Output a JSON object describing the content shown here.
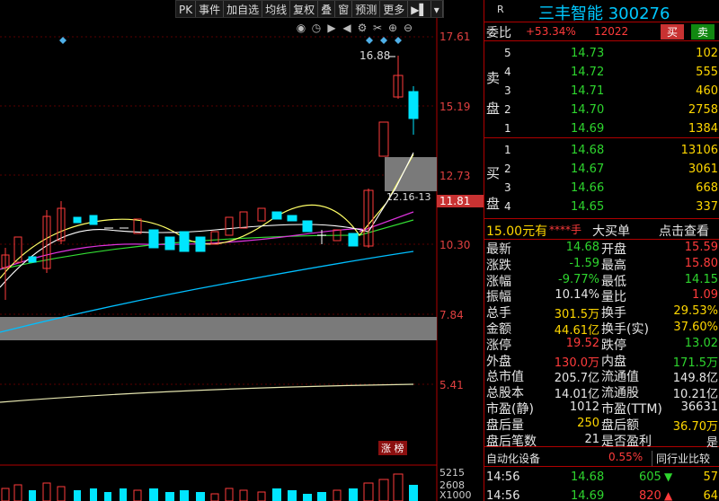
{
  "toolbar": {
    "items": [
      "PK",
      "事件",
      "加自选",
      "均线",
      "复权",
      "叠",
      "窗",
      "预测",
      "更多",
      "▶▌",
      "▾"
    ]
  },
  "chart_icons": [
    "eye-icon",
    "clock-icon",
    "play-icon",
    "back-icon",
    "gear-icon",
    "scissors-icon",
    "plus-icon",
    "minus-icon"
  ],
  "price_axis": [
    "17.61",
    "15.19",
    "12.73",
    "11.81",
    "10.30",
    "7.84",
    "5.41"
  ],
  "high_label": "16.88",
  "low_label": "12.16-13",
  "tag_zhangbang": "涨 榜",
  "vol_axis": [
    "5215",
    "2608",
    "X1000"
  ],
  "header": {
    "r": "R",
    "name": "三丰智能",
    "code": "300276",
    "wb_label": "委比",
    "wb_value": "+53.34%",
    "wc_value": "12022",
    "buy": "买",
    "sell": "卖"
  },
  "sell_levels": [
    {
      "level": "5",
      "price": "14.73",
      "vol": "102"
    },
    {
      "level": "4",
      "price": "14.72",
      "vol": "555"
    },
    {
      "level": "3",
      "price": "14.71",
      "vol": "460"
    },
    {
      "level": "2",
      "price": "14.70",
      "vol": "2758"
    },
    {
      "level": "1",
      "price": "14.69",
      "vol": "1384"
    }
  ],
  "buy_levels": [
    {
      "level": "1",
      "price": "14.68",
      "vol": "13106"
    },
    {
      "level": "2",
      "price": "14.67",
      "vol": "3061"
    },
    {
      "level": "3",
      "price": "14.66",
      "vol": "668"
    },
    {
      "level": "4",
      "price": "14.65",
      "vol": "337"
    }
  ],
  "side_labels": {
    "sell1": "卖",
    "sell2": "盘",
    "buy1": "买",
    "buy2": "盘"
  },
  "order": {
    "price": "15.00元有",
    "stars": "****手",
    "big": "大买单",
    "link": "点击查看"
  },
  "stats": [
    [
      "最新",
      "14.68",
      "开盘",
      "15.59"
    ],
    [
      "涨跌",
      "-1.59",
      "最高",
      "15.80"
    ],
    [
      "涨幅",
      "-9.77%",
      "最低",
      "14.15"
    ],
    [
      "振幅",
      "10.14%",
      "量比",
      "1.09"
    ],
    [
      "总手",
      "301.5万",
      "换手",
      "29.53%"
    ],
    [
      "金额",
      "44.61亿",
      "换手(实)",
      "37.60%"
    ],
    [
      "涨停",
      "19.52",
      "跌停",
      "13.02"
    ],
    [
      "外盘",
      "130.0万",
      "内盘",
      "171.5万"
    ],
    [
      "总市值",
      "205.7亿",
      "流通值",
      "149.8亿"
    ],
    [
      "总股本",
      "14.01亿",
      "流通股",
      "10.21亿"
    ],
    [
      "市盈(静)",
      "1012",
      "市盈(TTM)",
      "36631"
    ],
    [
      "盘后量",
      "250",
      "盘后额",
      "36.70万"
    ],
    [
      "盘后笔数",
      "21",
      "是否盈利",
      "是"
    ]
  ],
  "auto_device": {
    "label": "自动化设备",
    "pct": "0.55%",
    "btn": "同行业比较"
  },
  "ticks": [
    {
      "time": "14:56",
      "price": "14.68",
      "vol": "605",
      "n": "57"
    },
    {
      "time": "14:56",
      "price": "14.69",
      "vol": "820",
      "n": "64"
    }
  ]
}
